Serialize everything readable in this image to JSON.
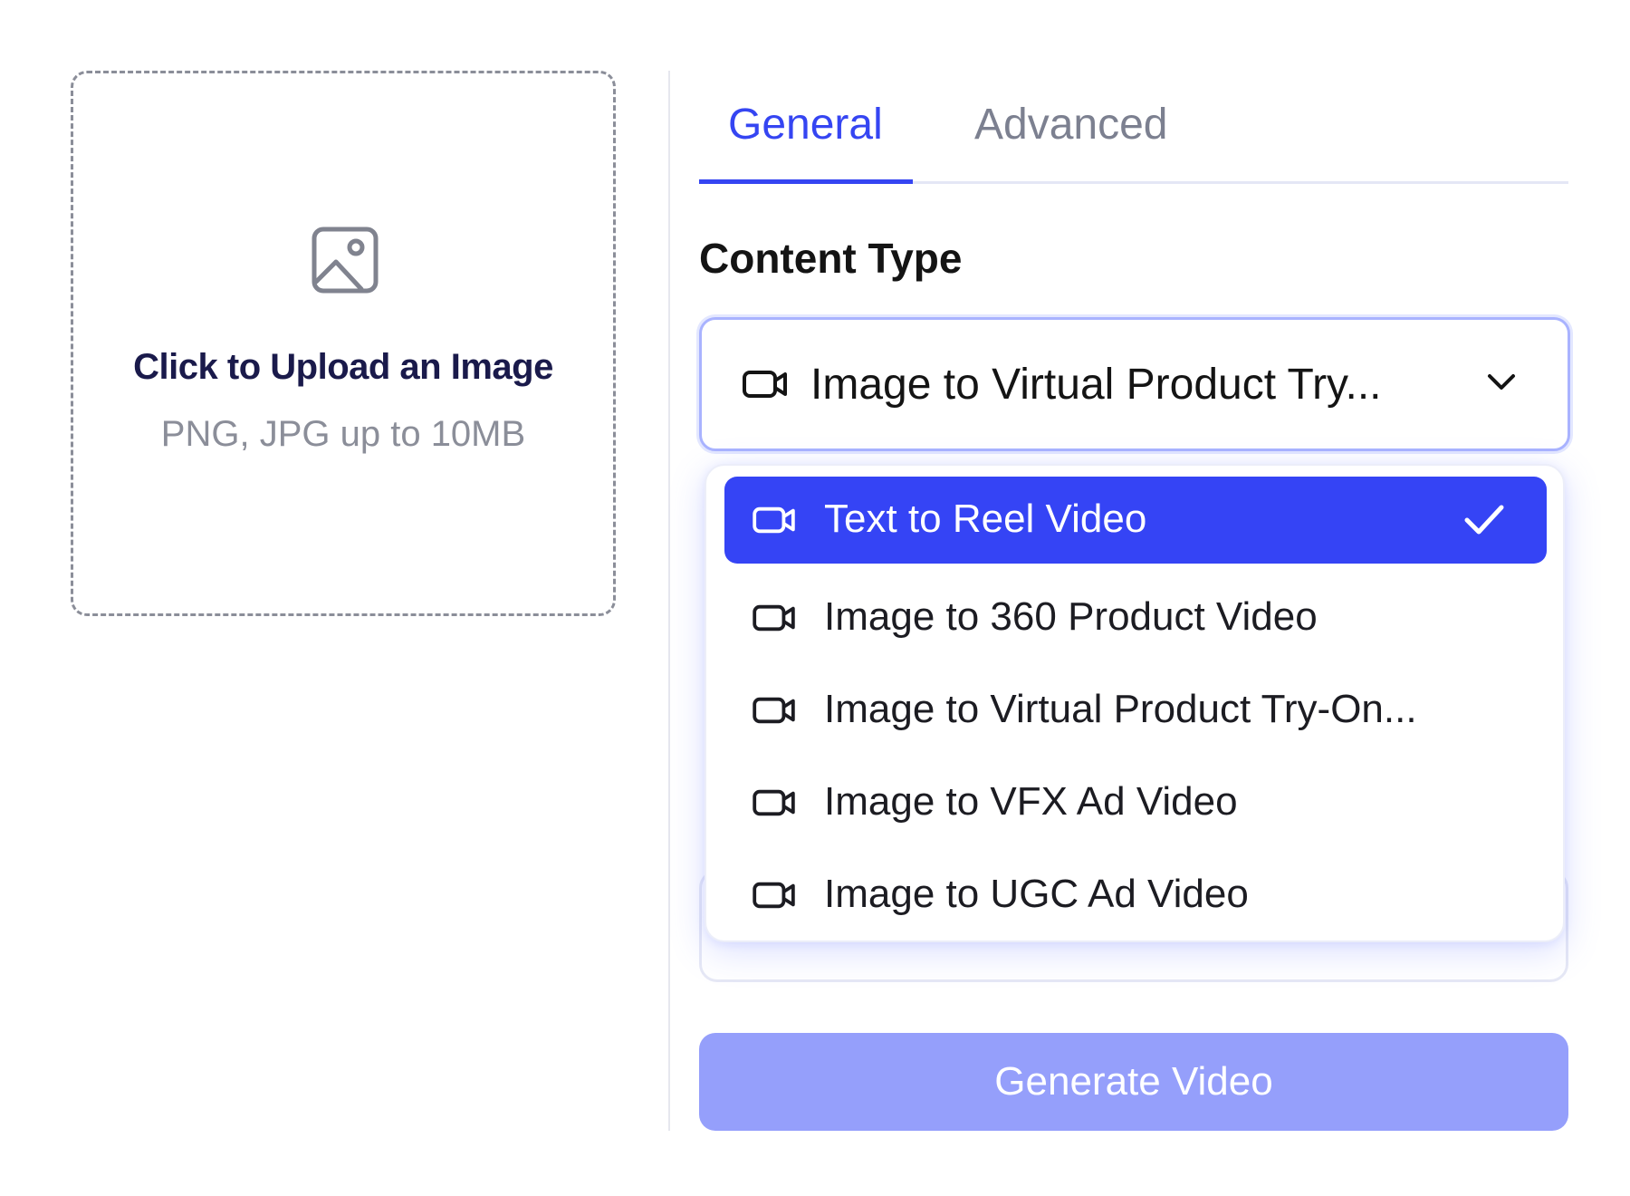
{
  "upload": {
    "title": "Click to Upload an Image",
    "subtitle": "PNG, JPG up to 10MB",
    "icon": "image-icon"
  },
  "tabs": [
    {
      "label": "General",
      "active": true
    },
    {
      "label": "Advanced",
      "active": false
    }
  ],
  "content_type": {
    "heading": "Content Type",
    "selected_label": "Image to Virtual Product Try...",
    "icon": "video-camera-icon",
    "options": [
      {
        "label": "Text to Reel Video",
        "selected": true
      },
      {
        "label": "Image to 360 Product Video",
        "selected": false
      },
      {
        "label": "Image to Virtual Product Try-On...",
        "selected": false
      },
      {
        "label": "Image to VFX Ad Video",
        "selected": false
      },
      {
        "label": "Image to UGC Ad Video",
        "selected": false
      }
    ]
  },
  "generate_button": {
    "label": "Generate Video"
  },
  "colors": {
    "accent": "#3545f2",
    "accent_selected_bg": "#3544f5",
    "button_disabled_bg": "#959ffb",
    "muted_text": "#8b8e99",
    "upload_title": "#1a1a4b"
  }
}
